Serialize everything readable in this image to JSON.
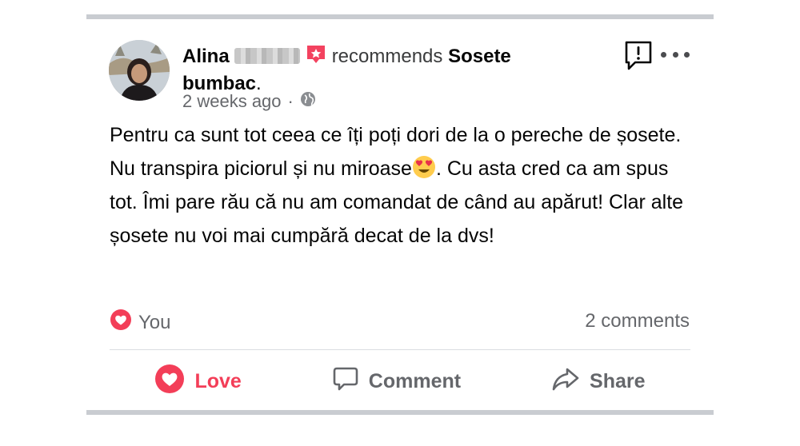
{
  "post": {
    "author_first_name": "Alina",
    "recommends_text": "recommends",
    "page_name": "Sosete bumbac",
    "period": ".",
    "timestamp": "2 weeks ago",
    "separator": "·",
    "body_before_emoji": "Pentru ca sunt tot ceea ce îți poți dori de la o pereche de șosete. Nu transpira piciorul și nu miroase",
    "body_after_emoji": ". Cu asta cred ca am spus tot. Îmi pare rău că nu am comandat de când au apărut! Clar alte șosete nu voi mai cumpără decat de la dvs!"
  },
  "reactions": {
    "reactor": "You",
    "comments_count": "2 comments"
  },
  "actions": {
    "love_label": "Love",
    "comment_label": "Comment",
    "share_label": "Share"
  },
  "colors": {
    "love": "#f33e58",
    "secondary_text": "#65676b",
    "divider": "#dadde1",
    "bar": "#c9ccd1"
  },
  "icons": [
    "recommend-badge-icon",
    "globe-icon",
    "report-icon",
    "more-icon",
    "heart-eyes-emoji",
    "love-reaction-icon",
    "comment-icon",
    "share-icon"
  ]
}
